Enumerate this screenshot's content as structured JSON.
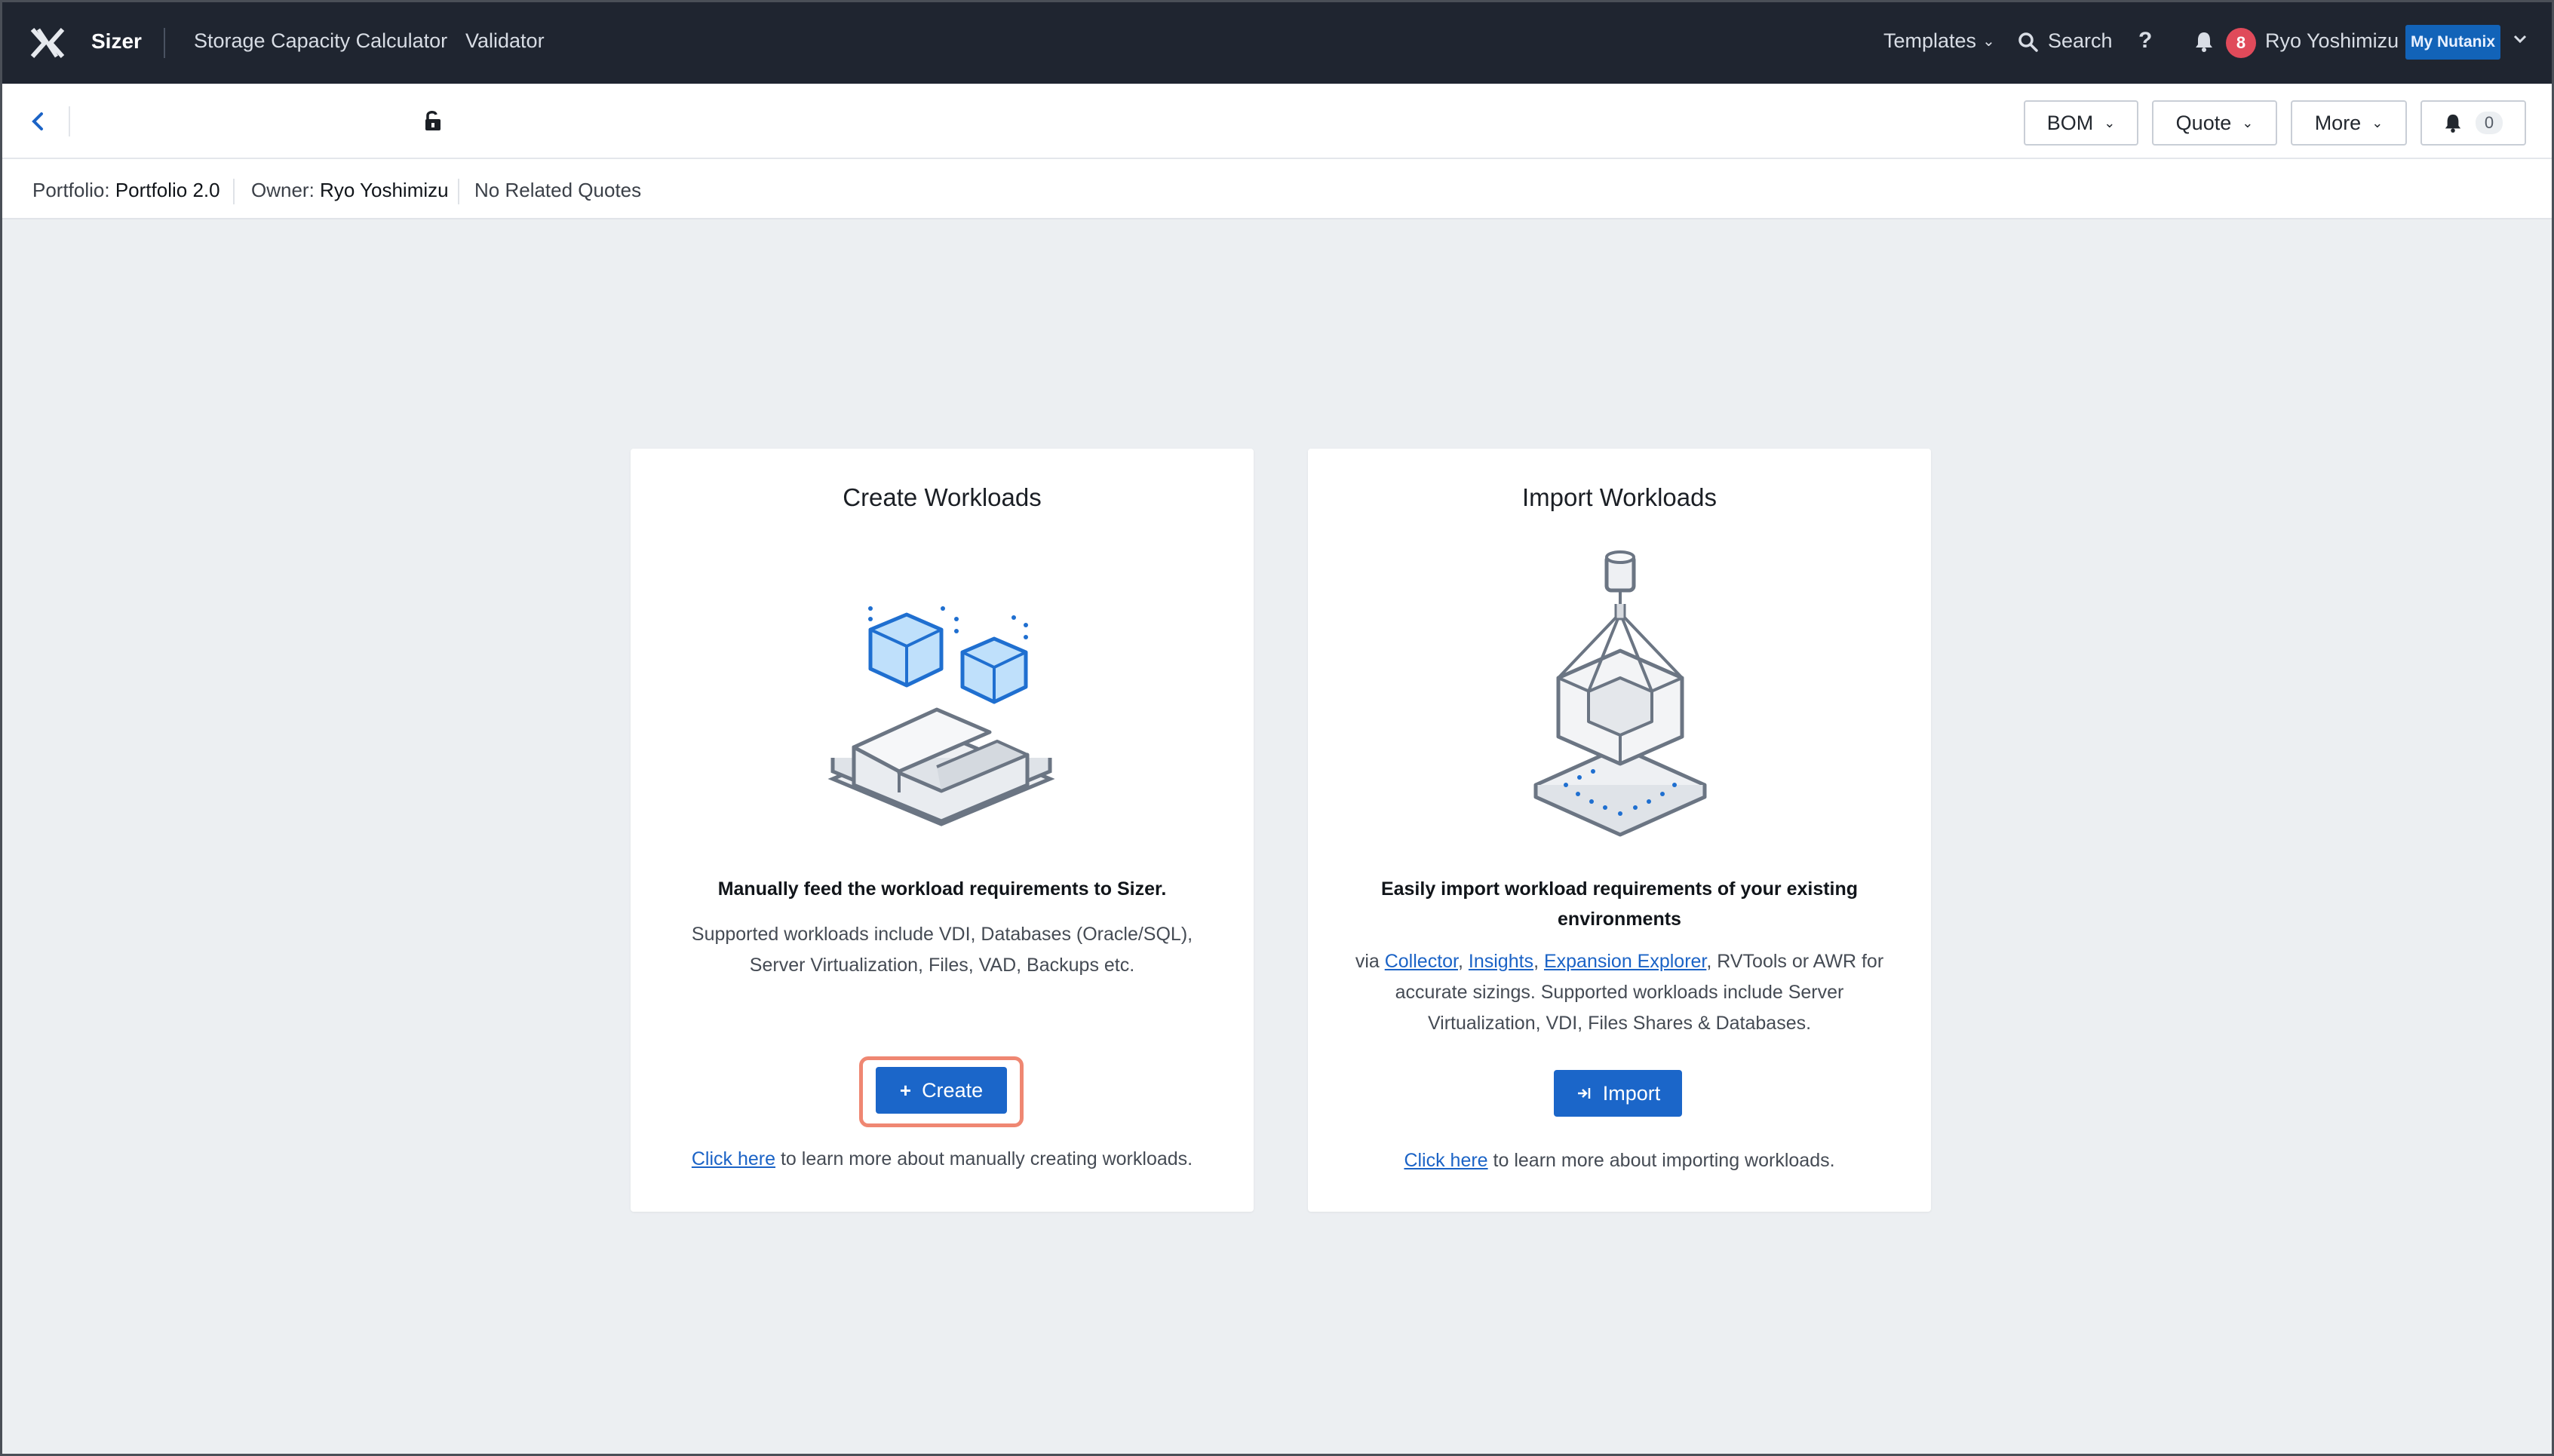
{
  "nav": {
    "brand": "Sizer",
    "links": [
      "Storage Capacity Calculator",
      "Validator"
    ],
    "templates": "Templates",
    "search": "Search",
    "help": "?",
    "notification_count": "8",
    "user": "Ryo Yoshimizu",
    "my_nutanix": "My Nutanix"
  },
  "header": {
    "bom": "BOM",
    "quote": "Quote",
    "more": "More",
    "alert_count": "0"
  },
  "info": {
    "portfolio_label": "Portfolio:",
    "portfolio_value": "Portfolio 2.0",
    "owner_label": "Owner:",
    "owner_value": "Ryo Yoshimizu",
    "quotes": "No Related Quotes"
  },
  "create": {
    "title": "Create Workloads",
    "strong": "Manually feed the workload requirements to Sizer.",
    "body": "Supported workloads include VDI, Databases (Oracle/SQL), Server Virtualization, Files, VAD, Backups etc.",
    "button": "Create",
    "learn_link": "Click here",
    "learn_text": " to learn more about manually creating workloads."
  },
  "import": {
    "title": "Import Workloads",
    "strong": "Easily import workload requirements of your existing environments",
    "via": "via ",
    "link_collector": "Collector",
    "link_insights": "Insights",
    "link_expansion": "Expansion Explorer",
    "body_tail": ", RVTools or AWR for accurate sizings. Supported workloads include Server Virtualization, VDI, Files Shares & Databases.",
    "button": "Import",
    "learn_link": "Click here",
    "learn_text": " to learn more about importing workloads."
  },
  "colors": {
    "nav_bg": "#1f2530",
    "primary": "#1b66c9",
    "highlight": "#ef8772",
    "badge": "#e04a5a"
  },
  "icons": [
    "nutanix-x-logo-icon",
    "chevron-down-icon",
    "search-icon",
    "bell-icon",
    "back-chevron-icon",
    "unlock-icon",
    "plus-icon",
    "import-arrow-icon"
  ]
}
